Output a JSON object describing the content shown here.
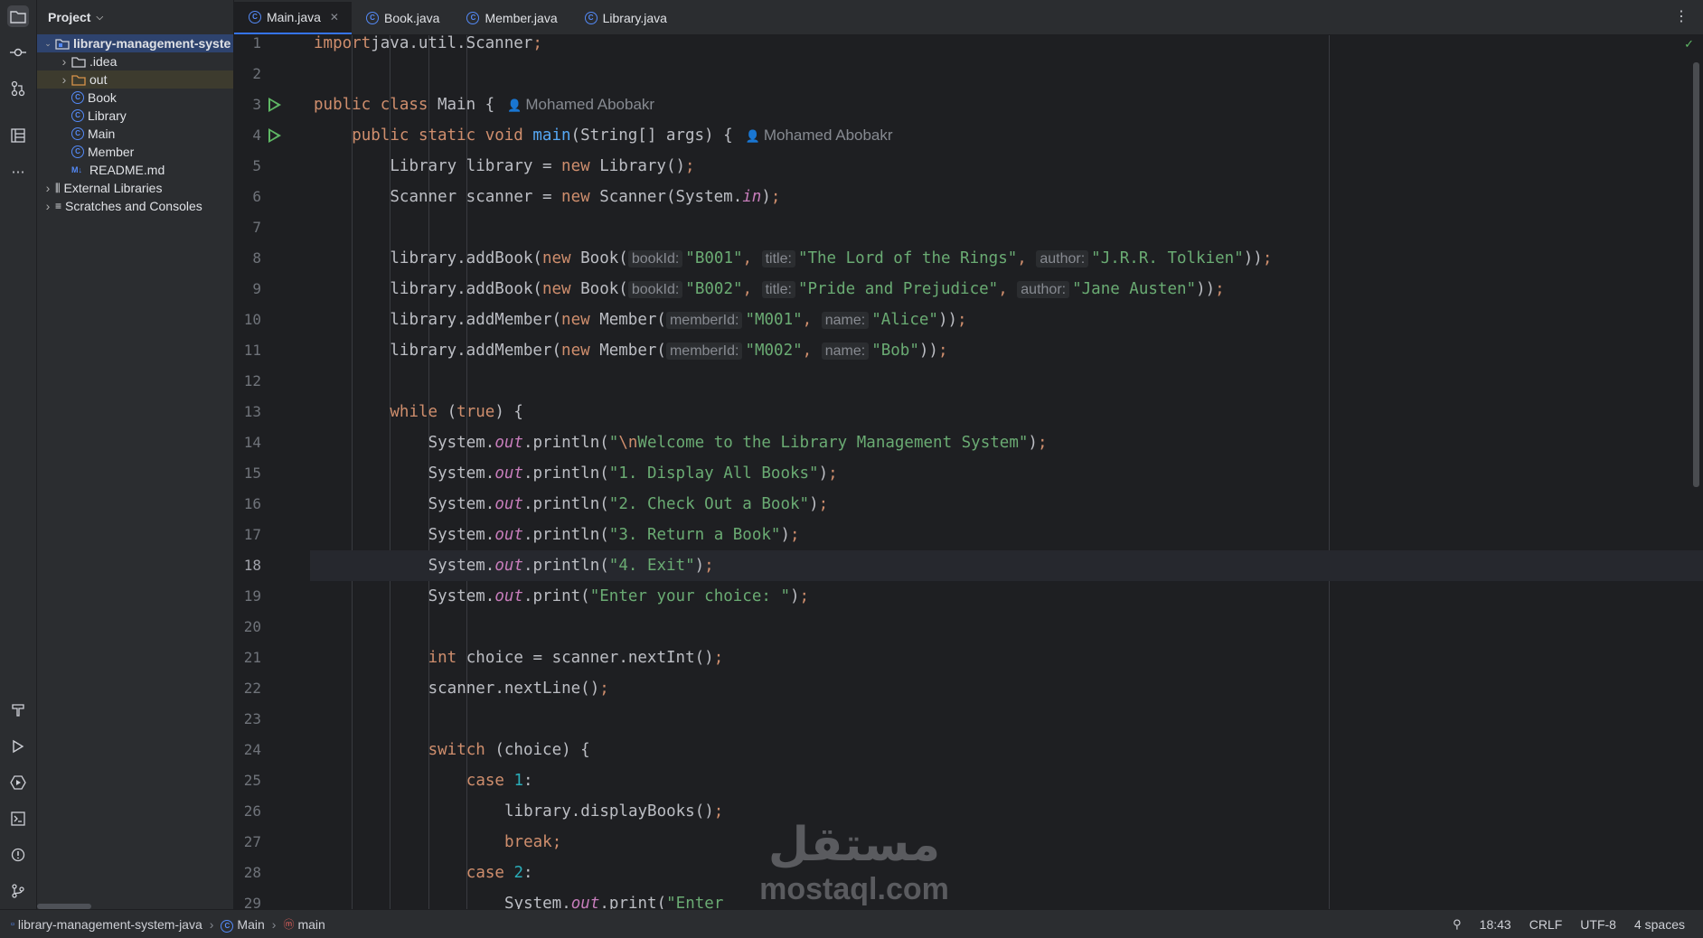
{
  "toolstrip": {
    "top_icons": [
      "folder-icon",
      "commit-icon",
      "pull-requests-icon",
      "structure-icon",
      "more-icon"
    ],
    "bottom_icons": [
      "build-icon",
      "run-icon",
      "services-icon",
      "terminal-icon",
      "problems-icon",
      "git-icon"
    ]
  },
  "project_panel": {
    "title": "Project",
    "tree": [
      {
        "label": "library-management-syste",
        "kind": "project",
        "depth": 0,
        "expanded": true,
        "selected": true
      },
      {
        "label": ".idea",
        "kind": "folder",
        "depth": 1,
        "expanded": false
      },
      {
        "label": "out",
        "kind": "folder-excluded",
        "depth": 1,
        "expanded": false
      },
      {
        "label": "Book",
        "kind": "class",
        "depth": 1
      },
      {
        "label": "Library",
        "kind": "class",
        "depth": 1
      },
      {
        "label": "Main",
        "kind": "class",
        "depth": 1
      },
      {
        "label": "Member",
        "kind": "class",
        "depth": 1
      },
      {
        "label": "README.md",
        "kind": "markdown",
        "depth": 1
      },
      {
        "label": "External Libraries",
        "kind": "libraries",
        "depth": 0,
        "expanded": false
      },
      {
        "label": "Scratches and Consoles",
        "kind": "scratches",
        "depth": 0,
        "expanded": false
      }
    ]
  },
  "tabs": [
    {
      "label": "Main.java",
      "active": true,
      "closable": true
    },
    {
      "label": "Book.java",
      "active": false
    },
    {
      "label": "Member.java",
      "active": false
    },
    {
      "label": "Library.java",
      "active": false
    }
  ],
  "editor": {
    "current_line": 18,
    "author": "Mohamed Abobakr",
    "lines": [
      {
        "n": "1",
        "indent": 0,
        "tokens": [
          [
            "kw",
            "import"
          ],
          [
            "",
            "java.util.Scanner"
          ],
          [
            "semi",
            ";"
          ]
        ]
      },
      {
        "n": "2",
        "indent": 0,
        "tokens": []
      },
      {
        "n": "3",
        "indent": 0,
        "run": true,
        "author": true,
        "tokens": [
          [
            "kw",
            "public class "
          ],
          [
            "",
            "Main {"
          ]
        ]
      },
      {
        "n": "4",
        "indent": 1,
        "run": true,
        "author": true,
        "tokens": [
          [
            "kw",
            "public static void "
          ],
          [
            "fnd",
            "main"
          ],
          [
            "",
            "(String[] args) {"
          ]
        ]
      },
      {
        "n": "5",
        "indent": 2,
        "tokens": [
          [
            "",
            "Library library = "
          ],
          [
            "kw",
            "new "
          ],
          [
            "",
            "Library()"
          ],
          [
            "semi",
            ";"
          ]
        ]
      },
      {
        "n": "6",
        "indent": 2,
        "tokens": [
          [
            "",
            "Scanner scanner = "
          ],
          [
            "kw",
            "new "
          ],
          [
            "",
            "Scanner(System."
          ],
          [
            "fld",
            "in"
          ],
          [
            "",
            ")"
          ],
          [
            "semi",
            ";"
          ]
        ]
      },
      {
        "n": "7",
        "indent": 0,
        "tokens": []
      },
      {
        "n": "8",
        "indent": 2,
        "tokens": [
          [
            "",
            "library.addBook("
          ],
          [
            "kw",
            "new "
          ],
          [
            "",
            "Book("
          ],
          [
            "hint",
            "bookId:"
          ],
          [
            "str",
            "\"B001\""
          ],
          [
            "semi",
            ", "
          ],
          [
            "hint",
            "title:"
          ],
          [
            "str",
            "\"The Lord of the Rings\""
          ],
          [
            "semi",
            ", "
          ],
          [
            "hint",
            "author:"
          ],
          [
            "str",
            "\"J.R.R. Tolkien\""
          ],
          [
            "",
            "))"
          ],
          [
            "semi",
            ";"
          ]
        ]
      },
      {
        "n": "9",
        "indent": 2,
        "tokens": [
          [
            "",
            "library.addBook("
          ],
          [
            "kw",
            "new "
          ],
          [
            "",
            "Book("
          ],
          [
            "hint",
            "bookId:"
          ],
          [
            "str",
            "\"B002\""
          ],
          [
            "semi",
            ", "
          ],
          [
            "hint",
            "title:"
          ],
          [
            "str",
            "\"Pride and Prejudice\""
          ],
          [
            "semi",
            ", "
          ],
          [
            "hint",
            "author:"
          ],
          [
            "str",
            "\"Jane Austen\""
          ],
          [
            "",
            "))"
          ],
          [
            "semi",
            ";"
          ]
        ]
      },
      {
        "n": "10",
        "indent": 2,
        "tokens": [
          [
            "",
            "library.addMember("
          ],
          [
            "kw",
            "new "
          ],
          [
            "",
            "Member("
          ],
          [
            "hint",
            "memberId:"
          ],
          [
            "str",
            "\"M001\""
          ],
          [
            "semi",
            ", "
          ],
          [
            "hint",
            "name:"
          ],
          [
            "str",
            "\"Alice\""
          ],
          [
            "",
            "))"
          ],
          [
            "semi",
            ";"
          ]
        ]
      },
      {
        "n": "11",
        "indent": 2,
        "tokens": [
          [
            "",
            "library.addMember("
          ],
          [
            "kw",
            "new "
          ],
          [
            "",
            "Member("
          ],
          [
            "hint",
            "memberId:"
          ],
          [
            "str",
            "\"M002\""
          ],
          [
            "semi",
            ", "
          ],
          [
            "hint",
            "name:"
          ],
          [
            "str",
            "\"Bob\""
          ],
          [
            "",
            "))"
          ],
          [
            "semi",
            ";"
          ]
        ]
      },
      {
        "n": "12",
        "indent": 0,
        "tokens": []
      },
      {
        "n": "13",
        "indent": 2,
        "tokens": [
          [
            "kw",
            "while "
          ],
          [
            "",
            "("
          ],
          [
            "kw",
            "true"
          ],
          [
            "",
            ") {"
          ]
        ]
      },
      {
        "n": "14",
        "indent": 3,
        "tokens": [
          [
            "",
            "System."
          ],
          [
            "fld",
            "out"
          ],
          [
            "",
            ".println("
          ],
          [
            "str",
            "\""
          ],
          [
            "esc",
            "\\n"
          ],
          [
            "str",
            "Welcome to the Library Management System\""
          ],
          [
            "",
            ")"
          ],
          [
            "semi",
            ";"
          ]
        ]
      },
      {
        "n": "15",
        "indent": 3,
        "tokens": [
          [
            "",
            "System."
          ],
          [
            "fld",
            "out"
          ],
          [
            "",
            ".println("
          ],
          [
            "str",
            "\"1. Display All Books\""
          ],
          [
            "",
            ")"
          ],
          [
            "semi",
            ";"
          ]
        ]
      },
      {
        "n": "16",
        "indent": 3,
        "tokens": [
          [
            "",
            "System."
          ],
          [
            "fld",
            "out"
          ],
          [
            "",
            ".println("
          ],
          [
            "str",
            "\"2. Check Out a Book\""
          ],
          [
            "",
            ")"
          ],
          [
            "semi",
            ";"
          ]
        ]
      },
      {
        "n": "17",
        "indent": 3,
        "tokens": [
          [
            "",
            "System."
          ],
          [
            "fld",
            "out"
          ],
          [
            "",
            ".println("
          ],
          [
            "str",
            "\"3. Return a Book\""
          ],
          [
            "",
            ")"
          ],
          [
            "semi",
            ";"
          ]
        ]
      },
      {
        "n": "18",
        "indent": 3,
        "tokens": [
          [
            "",
            "System."
          ],
          [
            "fld",
            "out"
          ],
          [
            "",
            ".println("
          ],
          [
            "str",
            "\"4. Exit\""
          ],
          [
            "",
            ")"
          ],
          [
            "semi",
            ";"
          ]
        ]
      },
      {
        "n": "19",
        "indent": 3,
        "tokens": [
          [
            "",
            "System."
          ],
          [
            "fld",
            "out"
          ],
          [
            "",
            ".print("
          ],
          [
            "str",
            "\"Enter your choice: \""
          ],
          [
            "",
            ")"
          ],
          [
            "semi",
            ";"
          ]
        ]
      },
      {
        "n": "20",
        "indent": 0,
        "tokens": []
      },
      {
        "n": "21",
        "indent": 3,
        "tokens": [
          [
            "kw",
            "int "
          ],
          [
            "",
            "choice = scanner.nextInt()"
          ],
          [
            "semi",
            ";"
          ]
        ]
      },
      {
        "n": "22",
        "indent": 3,
        "tokens": [
          [
            "",
            "scanner.nextLine()"
          ],
          [
            "semi",
            ";"
          ]
        ]
      },
      {
        "n": "23",
        "indent": 0,
        "tokens": []
      },
      {
        "n": "24",
        "indent": 3,
        "tokens": [
          [
            "kw",
            "switch "
          ],
          [
            "",
            "(choice) {"
          ]
        ]
      },
      {
        "n": "25",
        "indent": 4,
        "tokens": [
          [
            "kw",
            "case "
          ],
          [
            "num",
            "1"
          ],
          [
            "",
            ":"
          ]
        ]
      },
      {
        "n": "26",
        "indent": 5,
        "tokens": [
          [
            "",
            "library.displayBooks()"
          ],
          [
            "semi",
            ";"
          ]
        ]
      },
      {
        "n": "27",
        "indent": 5,
        "tokens": [
          [
            "kw",
            "break"
          ],
          [
            "semi",
            ";"
          ]
        ]
      },
      {
        "n": "28",
        "indent": 4,
        "tokens": [
          [
            "kw",
            "case "
          ],
          [
            "num",
            "2"
          ],
          [
            "",
            ":"
          ]
        ]
      },
      {
        "n": "29",
        "indent": 5,
        "tokens": [
          [
            "",
            "System."
          ],
          [
            "fld",
            "out"
          ],
          [
            "",
            ".print("
          ],
          [
            "str",
            "\"Enter"
          ]
        ]
      }
    ]
  },
  "watermark": {
    "arabic": "مستقل",
    "latin": "mostaql.com"
  },
  "statusbar": {
    "breadcrumb": [
      {
        "label": "library-management-system-java",
        "icon": "module-icon"
      },
      {
        "label": "Main",
        "icon": "class-icon"
      },
      {
        "label": "main",
        "icon": "method-icon"
      }
    ],
    "position": "18:43",
    "line_separator": "CRLF",
    "encoding": "UTF-8",
    "indent": "4 spaces"
  }
}
